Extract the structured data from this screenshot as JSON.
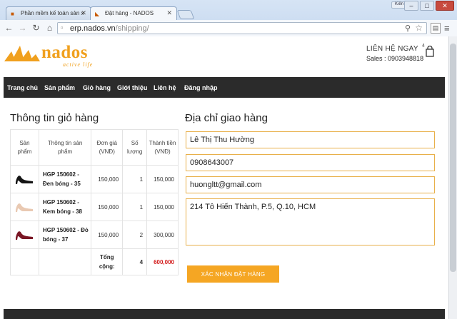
{
  "browser": {
    "tabs": [
      {
        "title": "Phần mềm kế toán sản xu",
        "active": false
      },
      {
        "title": "Đặt hàng - NADOS",
        "active": true
      }
    ],
    "window_user": "Kiên",
    "url_host": "erp.nados.vn",
    "url_path": "/shipping/"
  },
  "header": {
    "logo_word": "nados",
    "logo_tagline": "active life",
    "contact_title": "LIÊN HỆ NGAY",
    "contact_sales": "Sales : 0903948818",
    "cart_count": "4"
  },
  "nav": {
    "items": [
      "Trang chủ",
      "Sản phẩm",
      "Giỏ hàng",
      "Giới thiệu",
      "Liên hệ",
      "Đăng nhập"
    ]
  },
  "cart": {
    "title": "Thông tin giỏ hàng",
    "columns": [
      "Sản phẩm",
      "Thông tin sản phẩm",
      "Đơn giá (VNĐ)",
      "Số lượng",
      "Thành tiền (VNĐ)"
    ],
    "rows": [
      {
        "name": "HGP 150602 - Đen bóng - 35",
        "price": "150,000",
        "qty": "1",
        "amount": "150,000",
        "shoe_color": "#151515"
      },
      {
        "name": "HGP 150602 - Kem bóng - 38",
        "price": "150,000",
        "qty": "1",
        "amount": "150,000",
        "shoe_color": "#e9c9b2"
      },
      {
        "name": "HGP 150602 - Đỏ bóng - 37",
        "price": "150,000",
        "qty": "2",
        "amount": "300,000",
        "shoe_color": "#7a1624"
      }
    ],
    "total_label": "Tổng cộng:",
    "total_qty": "4",
    "total_amount": "600,000"
  },
  "shipping": {
    "title": "Địa chỉ giao hàng",
    "name": "Lê Thị Thu Hường",
    "phone": "0908643007",
    "email": "huongltt@gmail.com",
    "address": "214 Tô Hiến Thành, P.5, Q.10, HCM",
    "confirm_label": "XÁC NHẬN ĐẶT HÀNG"
  },
  "colors": {
    "accent": "#f5a623",
    "nav_bg": "#2b2b2b",
    "total_red": "#d21919"
  }
}
